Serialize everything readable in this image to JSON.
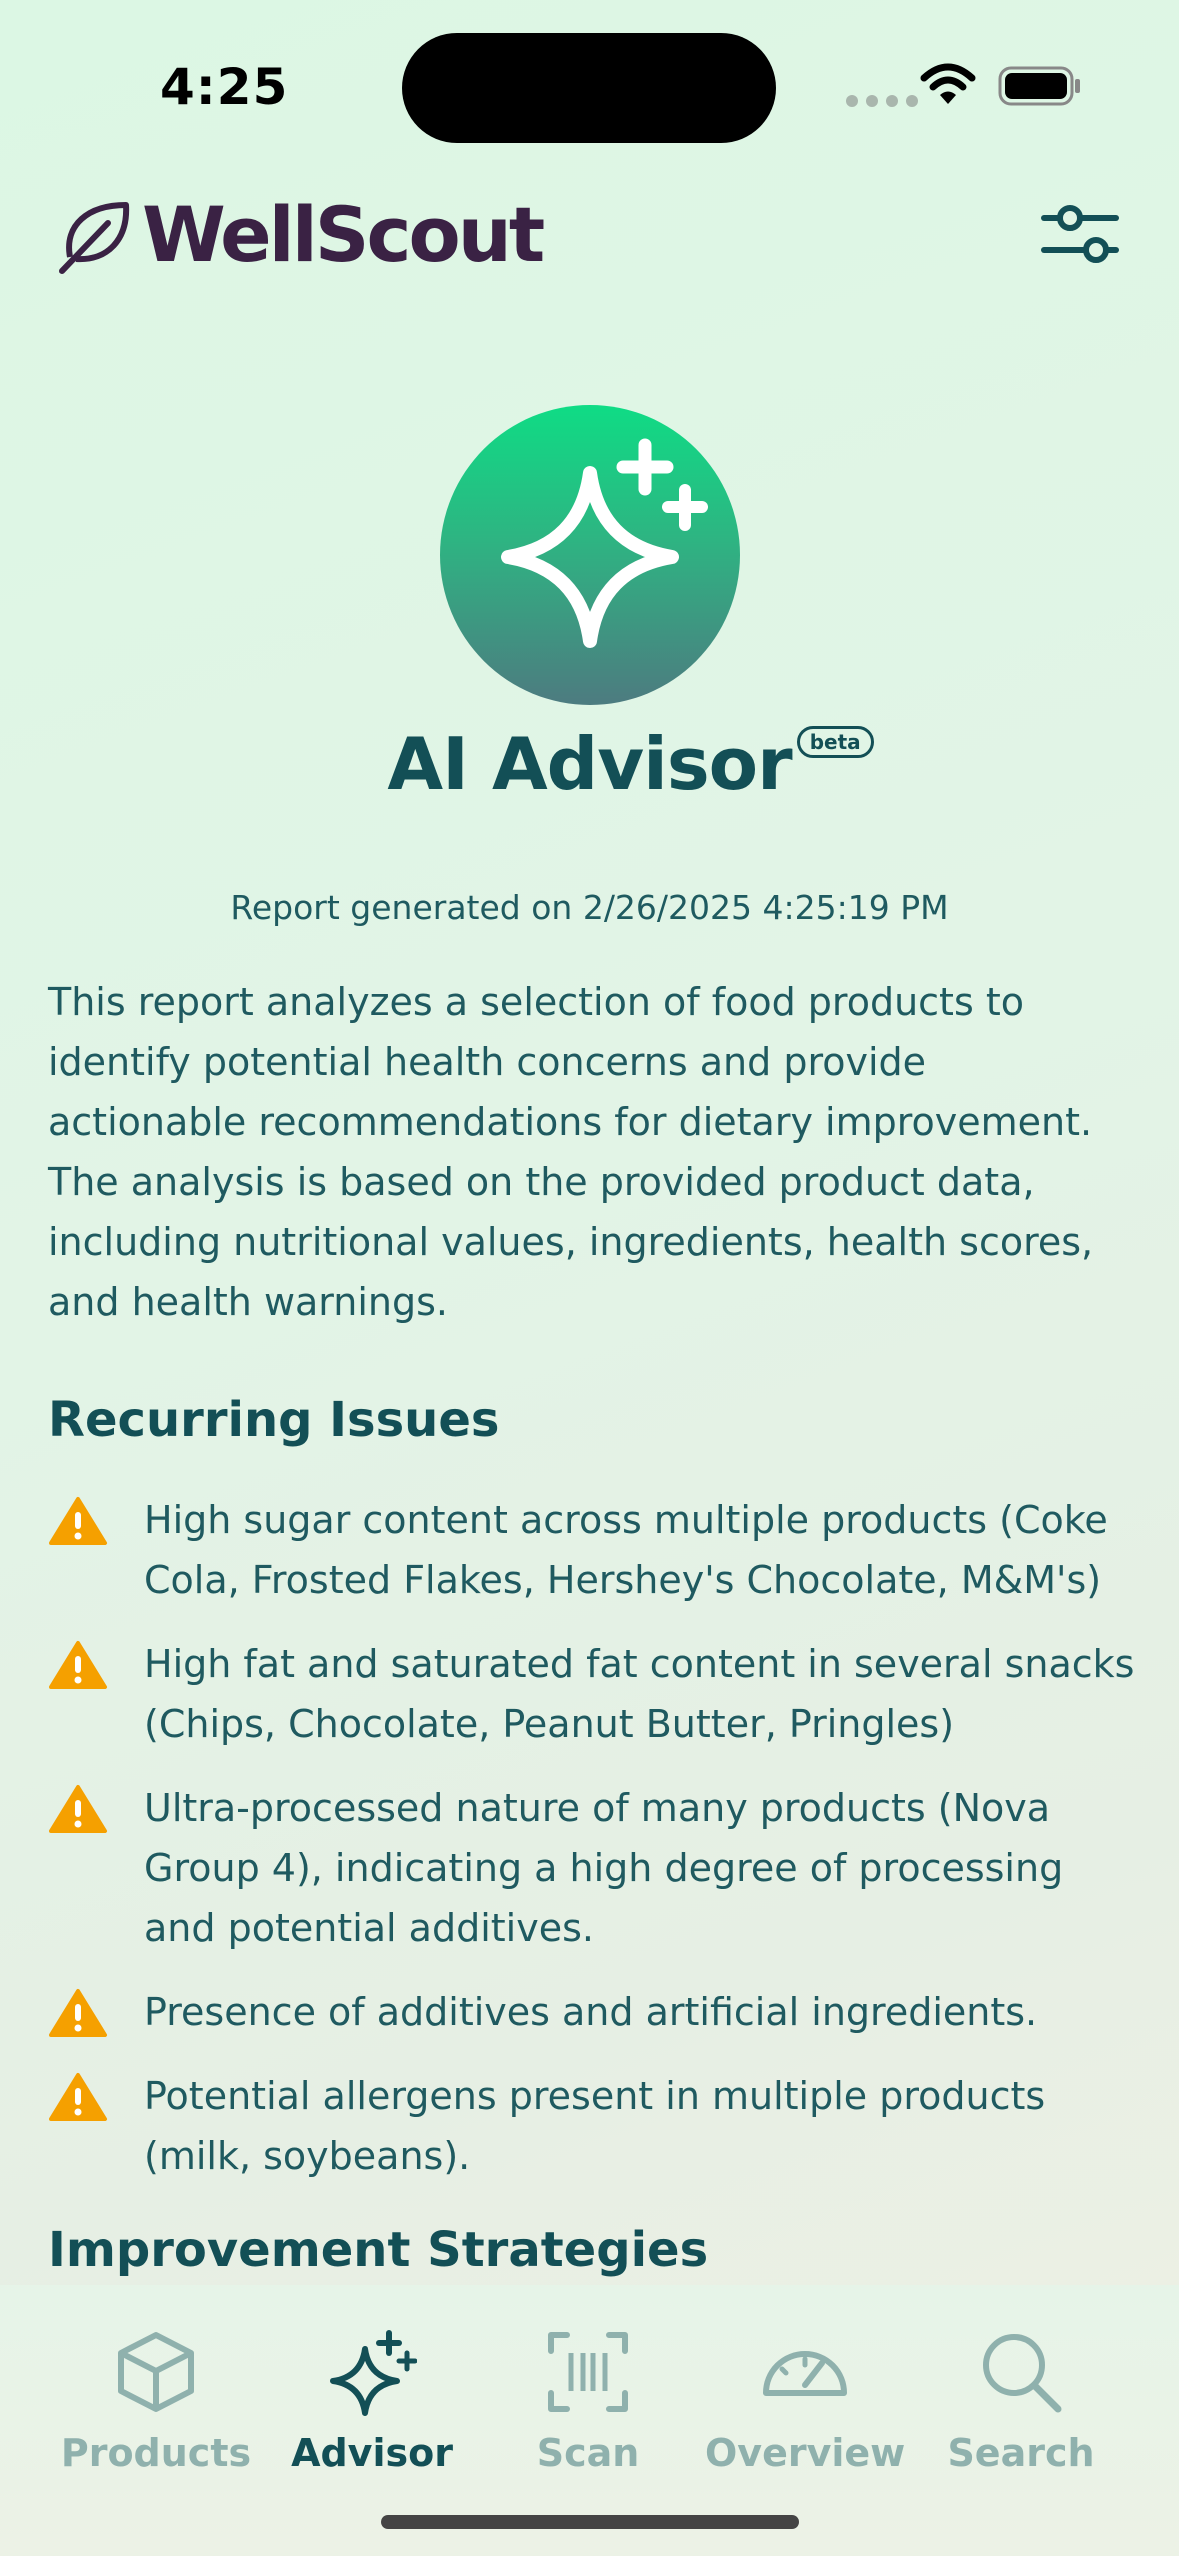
{
  "status_bar": {
    "time": "4:25"
  },
  "header": {
    "app_name": "WellScout",
    "logo_icon": "leaf-icon",
    "filter_icon": "sliders-icon"
  },
  "hero": {
    "icon": "sparkles-icon",
    "title": "AI Advisor",
    "badge": "beta"
  },
  "report": {
    "generated": "Report generated on 2/26/2025 4:25:19 PM",
    "intro": "This report analyzes a selection of food products to identify potential health concerns and provide actionable recommendations for dietary improvement. The analysis is based on the provided product data, including nutritional values, ingredients, health scores, and health warnings."
  },
  "recurring_issues": {
    "title": "Recurring Issues",
    "items": [
      "High sugar content across multiple products (Coke Cola, Frosted Flakes, Hershey's Chocolate, M&M's)",
      "High fat and saturated fat content in several snacks (Chips, Chocolate, Peanut Butter, Pringles)",
      "Ultra-processed nature of many products (Nova Group 4), indicating a high degree of processing and potential additives.",
      "Presence of additives and artificial ingredients.",
      "Potential allergens present in multiple products (milk, soybeans)."
    ]
  },
  "improvement": {
    "title": "Improvement Strategies"
  },
  "tabs": [
    {
      "label": "Products",
      "icon": "cube-icon",
      "active": false
    },
    {
      "label": "Advisor",
      "icon": "sparkles-icon",
      "active": true
    },
    {
      "label": "Scan",
      "icon": "barcode-scan-icon",
      "active": false
    },
    {
      "label": "Overview",
      "icon": "gauge-icon",
      "active": false
    },
    {
      "label": "Search",
      "icon": "search-icon",
      "active": false
    }
  ],
  "colors": {
    "primary": "#134f56",
    "brand": "#3a2244",
    "warning": "#f5a000",
    "inactive": "#8fb1ad"
  }
}
